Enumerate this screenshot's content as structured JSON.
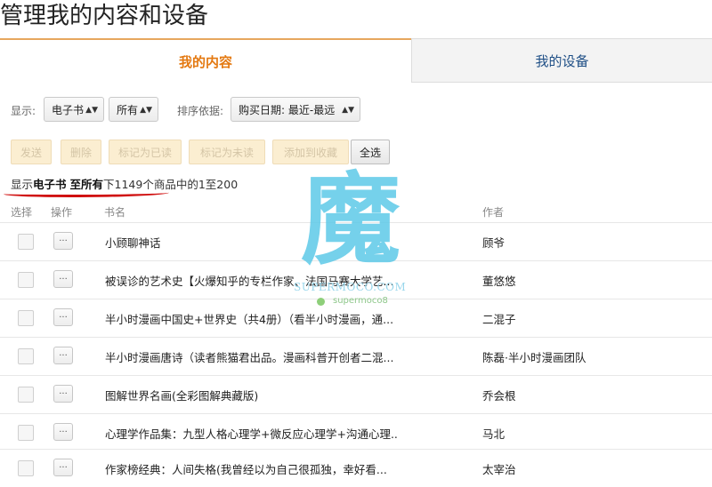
{
  "page": {
    "title": "管理我的内容和设备"
  },
  "tabs": [
    {
      "label": "我的内容",
      "active": true
    },
    {
      "label": "我的设备",
      "active": false
    }
  ],
  "filters": {
    "show_label": "显示:",
    "type_value": "电子书",
    "scope_value": "所有",
    "sort_label": "排序依据:",
    "sort_value": "购买日期: 最近-最远"
  },
  "actions": {
    "send": "发送",
    "delete": "删除",
    "mark_read": "标记为已读",
    "mark_unread": "标记为未读",
    "add_collection": "添加到收藏",
    "select_all": "全选"
  },
  "summary": {
    "prefix": "显示",
    "type": "电子书",
    "mid": "至所有",
    "suffix": "下1149个商品中的1至200"
  },
  "table": {
    "headers": {
      "select": "选择",
      "action": "操作",
      "title": "书名",
      "author": "作者"
    },
    "action_button_label": "...",
    "rows": [
      {
        "title": "小顾聊神话",
        "author": "顾爷"
      },
      {
        "title": "被误诊的艺术史【火爆知乎的专栏作家、法国马赛大学艺...",
        "author": "董悠悠"
      },
      {
        "title": "半小时漫画中国史+世界史（共4册）（看半小时漫画，通...",
        "author": "二混子"
      },
      {
        "title": "半小时漫画唐诗（读者熊猫君出品。漫画科普开创者二混...",
        "author": "陈磊·半小时漫画团队"
      },
      {
        "title": "图解世界名画(全彩图解典藏版)",
        "author": "乔会根"
      },
      {
        "title": "心理学作品集：九型人格心理学+微反应心理学+沟通心理...",
        "author": "马北"
      },
      {
        "title": "作家榜经典：人间失格(我曾经以为自己很孤独，幸好看...",
        "author": "太宰治"
      }
    ]
  },
  "watermark": {
    "glyph": "魔",
    "text1": "SUPERMOCO.COM",
    "text2": "supermoco8"
  },
  "colors": {
    "accent": "#e47911",
    "tab_link": "#1f4f86",
    "disabled_button_bg": "#fbeed1",
    "highlight_underline": "#d01010"
  }
}
